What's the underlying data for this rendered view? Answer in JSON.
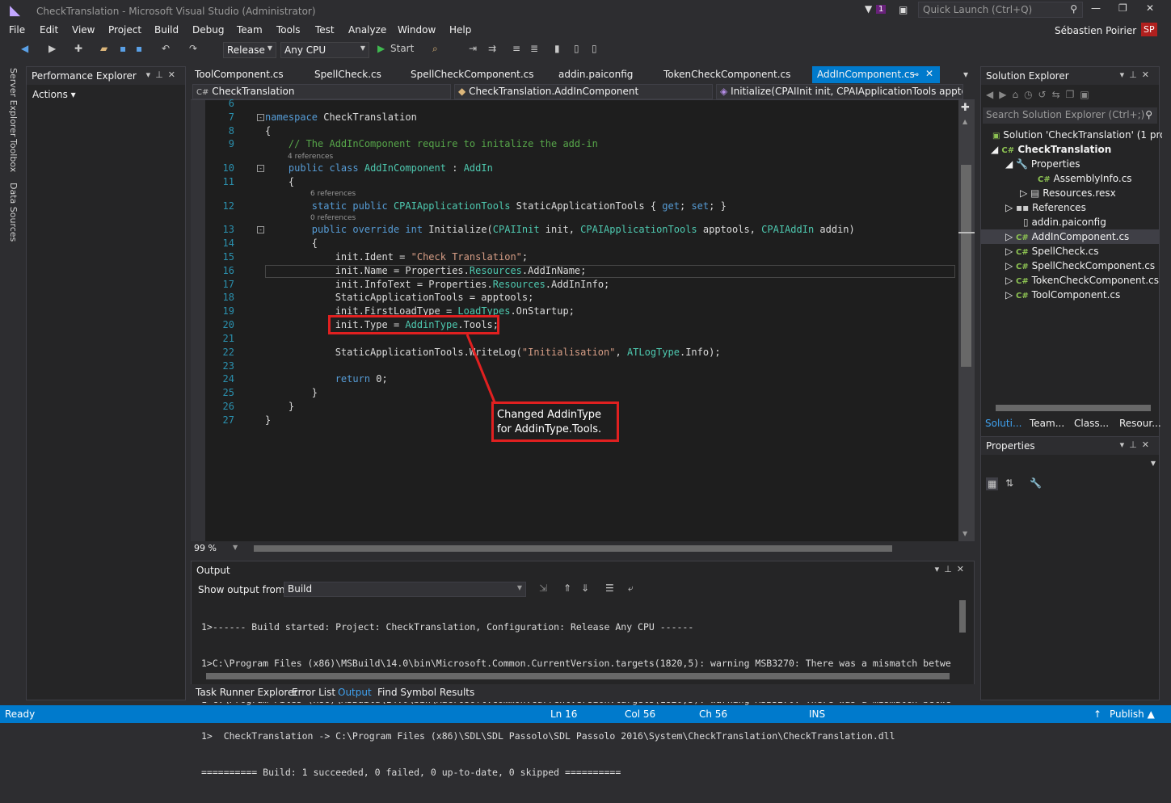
{
  "title": "CheckTranslation - Microsoft Visual Studio (Administrator)",
  "quick_launch": "Quick Launch (Ctrl+Q)",
  "notif_count": "1",
  "user": "Sébastien Poirier",
  "user_initials": "SP",
  "menu": [
    "File",
    "Edit",
    "View",
    "Project",
    "Build",
    "Debug",
    "Team",
    "Tools",
    "Test",
    "Analyze",
    "Window",
    "Help"
  ],
  "toolbar": {
    "config": "Release",
    "platform": "Any CPU",
    "start": "Start"
  },
  "left_tabs": [
    "Server Explorer",
    "Toolbox",
    "Data Sources"
  ],
  "perf": {
    "title": "Performance Explorer",
    "actions": "Actions"
  },
  "doc_tabs": [
    "ToolComponent.cs",
    "SpellCheck.cs",
    "SpellCheckComponent.cs",
    "addin.paiconfig",
    "TokenCheckComponent.cs",
    "AddInComponent.cs"
  ],
  "nav": {
    "project": "CheckTranslation",
    "class": "CheckTranslation.AddInComponent",
    "member": "Initialize(CPAIInit init, CPAIApplicationTools apptools,"
  },
  "code": {
    "l6": "6",
    "l7": "7",
    "l8": "8",
    "l9": "9",
    "l10": "10",
    "l11": "11",
    "l12": "12",
    "l13": "13",
    "l14": "14",
    "l15": "15",
    "l16": "16",
    "l17": "17",
    "l18": "18",
    "l19": "19",
    "l20": "20",
    "l21": "21",
    "l22": "22",
    "l23": "23",
    "l24": "24",
    "l25": "25",
    "l26": "26",
    "l27": "27",
    "ref4": "4 references",
    "ref6": "6 references",
    "ref0": "0 references"
  },
  "zoom": "99 %",
  "output": {
    "title": "Output",
    "show_from_label": "Show output from:",
    "source": "Build",
    "lines": [
      "1>------ Build started: Project: CheckTranslation, Configuration: Release Any CPU ------",
      "1>C:\\Program Files (x86)\\MSBuild\\14.0\\bin\\Microsoft.Common.CurrentVersion.targets(1820,5): warning MSB3270: There was a mismatch betwe",
      "1>C:\\Program Files (x86)\\MSBuild\\14.0\\bin\\Microsoft.Common.CurrentVersion.targets(1820,5): warning MSB3270: There was a mismatch betwe",
      "1>  CheckTranslation -> C:\\Program Files (x86)\\SDL\\SDL Passolo\\SDL Passolo 2016\\System\\CheckTranslation\\CheckTranslation.dll",
      "========== Build: 1 succeeded, 0 failed, 0 up-to-date, 0 skipped =========="
    ]
  },
  "bottom_tabs": [
    "Task Runner Explorer",
    "Error List",
    "Output",
    "Find Symbol Results"
  ],
  "solution": {
    "title": "Solution Explorer",
    "search": "Search Solution Explorer (Ctrl+;)",
    "root": "Solution 'CheckTranslation' (1 proje",
    "project": "CheckTranslation",
    "properties": "Properties",
    "assemblyinfo": "AssemblyInfo.cs",
    "resources": "Resources.resx",
    "references": "References",
    "addin_cfg": "addin.paiconfig",
    "files": [
      "AddInComponent.cs",
      "SpellCheck.cs",
      "SpellCheckComponent.cs",
      "TokenCheckComponent.cs",
      "ToolComponent.cs"
    ],
    "tabs": [
      "Soluti...",
      "Team...",
      "Class...",
      "Resour..."
    ]
  },
  "props_title": "Properties",
  "status": {
    "ready": "Ready",
    "ln": "Ln 16",
    "col": "Col 56",
    "ch": "Ch 56",
    "ins": "INS",
    "publish": "Publish"
  },
  "annotation": "Changed AddinType for AddinType.Tools.",
  "colors": {
    "accent": "#007acc",
    "annotation": "#e02020",
    "editor_bg": "#1e1e1e"
  }
}
